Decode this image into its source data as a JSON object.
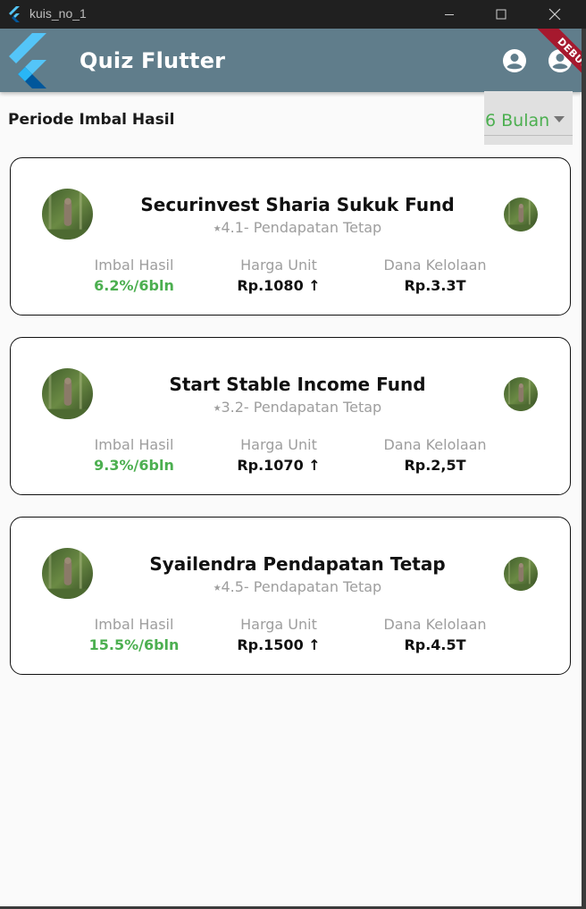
{
  "window": {
    "title": "kuis_no_1"
  },
  "appbar": {
    "title": "Quiz Flutter",
    "debug_label": "DEBUG"
  },
  "period": {
    "label": "Periode Imbal Hasil",
    "selected": "6 Bulan"
  },
  "colors": {
    "appbar": "#607d8b",
    "accent_green": "#4caf50",
    "debug_ribbon": "#a6192e"
  },
  "cards": [
    {
      "name": "Securinvest Sharia Sukuk Fund",
      "rating": "⭑4.1- Pendapatan Tetap",
      "stats": [
        {
          "label": "Imbal Hasil",
          "value": "6.2%/6bln"
        },
        {
          "label": "Harga Unit",
          "value": "Rp.1080 ↑"
        },
        {
          "label": "Dana Kelolaan",
          "value": "Rp.3.3T"
        }
      ]
    },
    {
      "name": "Start Stable Income Fund",
      "rating": "⭑3.2- Pendapatan Tetap",
      "stats": [
        {
          "label": "Imbal Hasil",
          "value": "9.3%/6bln"
        },
        {
          "label": "Harga Unit",
          "value": "Rp.1070 ↑"
        },
        {
          "label": "Dana Kelolaan",
          "value": "Rp.2,5T"
        }
      ]
    },
    {
      "name": "Syailendra Pendapatan Tetap",
      "rating": "⭑4.5- Pendapatan Tetap",
      "stats": [
        {
          "label": "Imbal Hasil",
          "value": "15.5%/6bln"
        },
        {
          "label": "Harga Unit",
          "value": "Rp.1500 ↑"
        },
        {
          "label": "Dana Kelolaan",
          "value": "Rp.4.5T"
        }
      ]
    }
  ]
}
